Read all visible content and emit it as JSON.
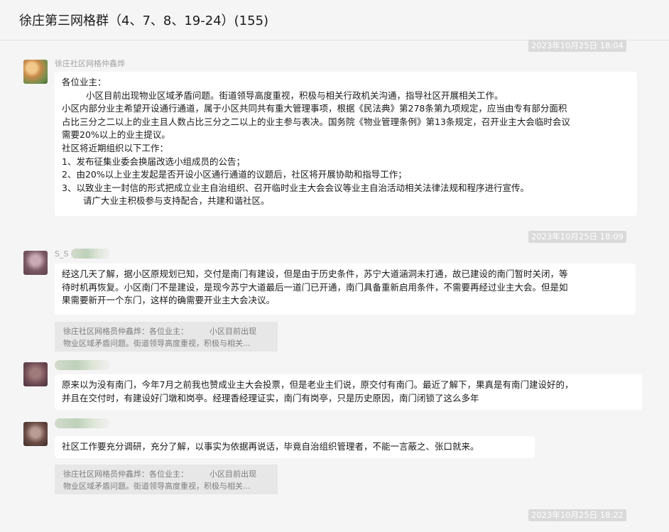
{
  "header": {
    "title": "徐庄第三网格群（4、7、8、19-24）(155)"
  },
  "timestamps": [
    "2023年10月25日 18:04",
    "2023年10月25日 18:09",
    "2023年10月25日 18:22"
  ],
  "messages": [
    {
      "sender": "徐庄社区网格仲鑫烨",
      "lines": [
        "各位业主：",
        "小区目前出现物业区域矛盾问题。街道领导高度重视，积极与相关行政机关沟通，指导社区开展相关工作。",
        "小区内部分业主希望开设通行通道，属于小区共同共有重大管理事项，根据《民法典》第278条第九项规定，应当由专有部分面积",
        "占比三分之二以上的业主且人数占比三分之二以上的业主参与表决。国务院《物业管理条例》第13条规定，召开业主大会临时会议",
        "需要20%以上的业主提议。",
        "社区将近期组织以下工作：",
        "1、发布征集业委会换届改选小组成员的公告；",
        "2、由20%以上业主发起是否开设小区通行通道的议题后，社区将开展协助和指导工作；",
        "3、以致业主一封信的形式把成立业主自治组织、召开临时业主大会会议等业主自治活动相关法律法规和程序进行宣传。",
        "请广大业主积极参与支持配合，共建和谐社区。"
      ]
    },
    {
      "sender": "S_S",
      "lines": [
        "经这几天了解，据小区原规划已知，交付是南门有建设，但是由于历史条件，苏宁大道涵洞未打通，故已建设的南门暂时关闭，等",
        "待时机再恢复。小区南门不是建设，是现今苏宁大道最后一道门已开通，南门具备重新启用条件，不需要再经过业主大会。但是如",
        "果需要新开一个东门，这样的确需要开业主大会决议。"
      ],
      "quote": [
        "徐庄社区网格员仲鑫烨：各位业主：",
        "小区目前出现",
        "物业区域矛盾问题。街道领导高度重视，积极与相关..."
      ]
    },
    {
      "lines": [
        "原来以为没有南门，今年7月之前我也赞成业主大会投票，但是老业主们说，原交付有南门。最近了解下，果真是有南门建设好的，",
        "并且在交付时，有建设好门墩和岗亭。经理香经理证实，南门有岗亭，只是历史原因，南门闭锁了这么多年"
      ]
    },
    {
      "lines": [
        "社区工作要充分调研，充分了解，以事实为依据再说话，毕竟自治组织管理者，不能一言蔽之、张口就来。"
      ],
      "quote": [
        "徐庄社区网格员仲鑫烨：各位业主：",
        "小区目前出现",
        "物业区域矛盾问题。街道领导高度重视，积极与相关..."
      ]
    }
  ],
  "colors": {
    "background": "#f5f5f5",
    "bubble": "#ffffff",
    "timestamp_bg": "#dadada",
    "quote_bg": "#e7e7e7"
  }
}
